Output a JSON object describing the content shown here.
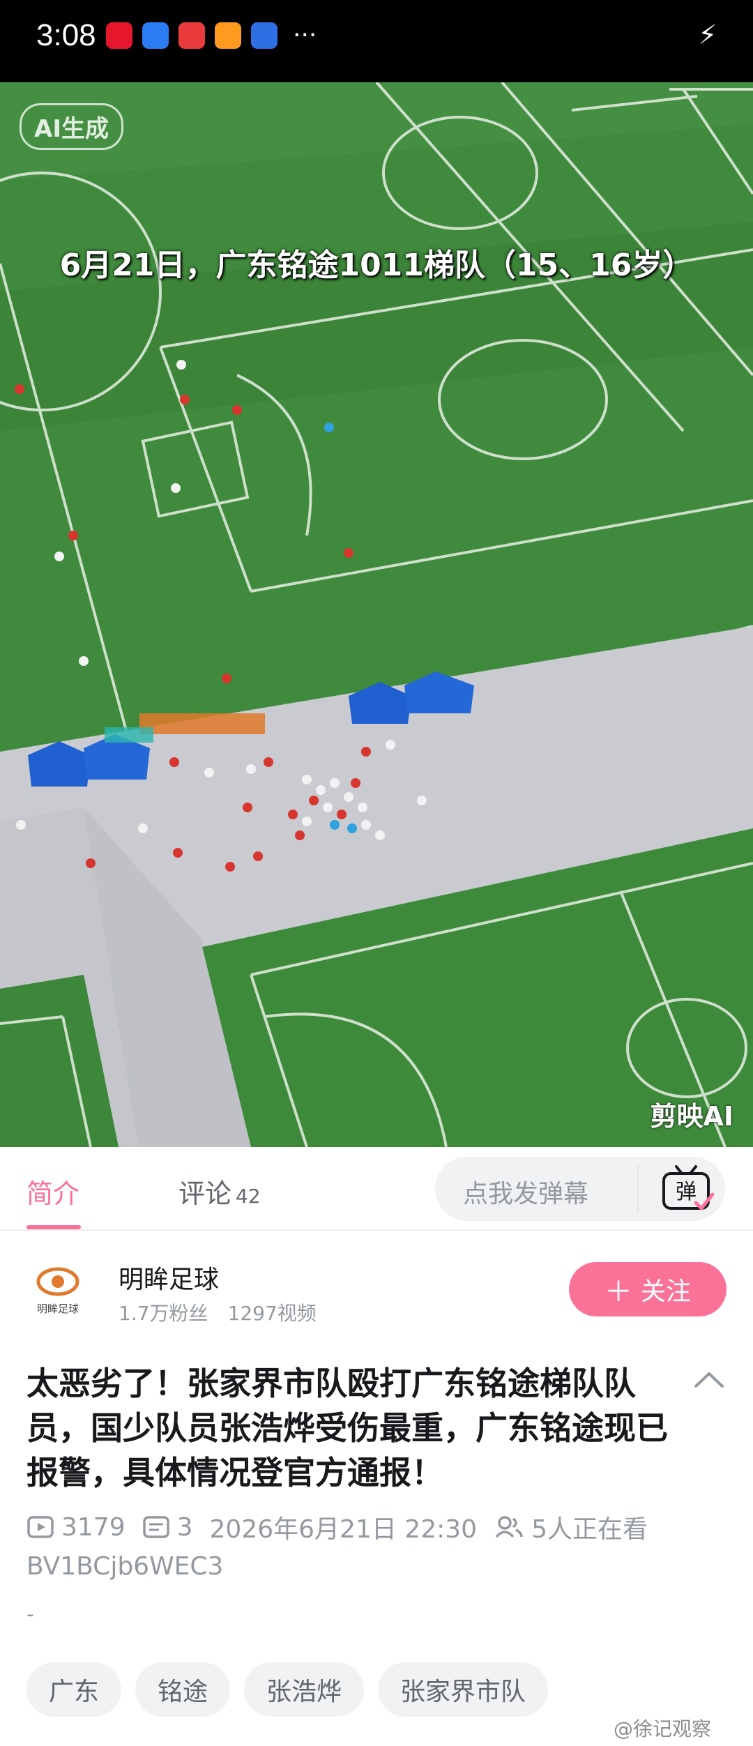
{
  "status_bar": {
    "time": "3:08",
    "app_icons": [
      "weibo-icon",
      "app-blue-icon",
      "app-red-icon",
      "app-orange-icon",
      "baidu-icon"
    ],
    "more": "···"
  },
  "video": {
    "ai_badge": "AI生成",
    "caption": "6月21日，广东铭途1011梯队（15、16岁）",
    "watermark": "剪映AI"
  },
  "tabs": {
    "intro": "简介",
    "comments": "评论",
    "comments_count": "42",
    "danmaku_placeholder": "点我发弹幕",
    "danmaku_button": "弹"
  },
  "uploader": {
    "name": "明眸足球",
    "avatar_text": "明眸足球",
    "fans": "1.7万粉丝",
    "videos": "1297视频",
    "follow": "关注"
  },
  "video_info": {
    "title": "太恶劣了！张家界市队殴打广东铭途梯队队员，国少队员张浩烨受伤最重，广东铭途现已报警，具体情况登官方通报！",
    "plays": "3179",
    "danmaku_count": "3",
    "date": "2026年6月21日 22:30",
    "watching": "5人正在看",
    "bvid": "BV1BCjb6WEC3",
    "desc": "-"
  },
  "tags": [
    "广东",
    "铭途",
    "张浩烨",
    "张家界市队"
  ],
  "watermark": "@徐记观察",
  "colors": {
    "accent": "#fb7299",
    "text": "#18191c",
    "muted": "#9499a0",
    "pitch": "#3f8a3c"
  }
}
